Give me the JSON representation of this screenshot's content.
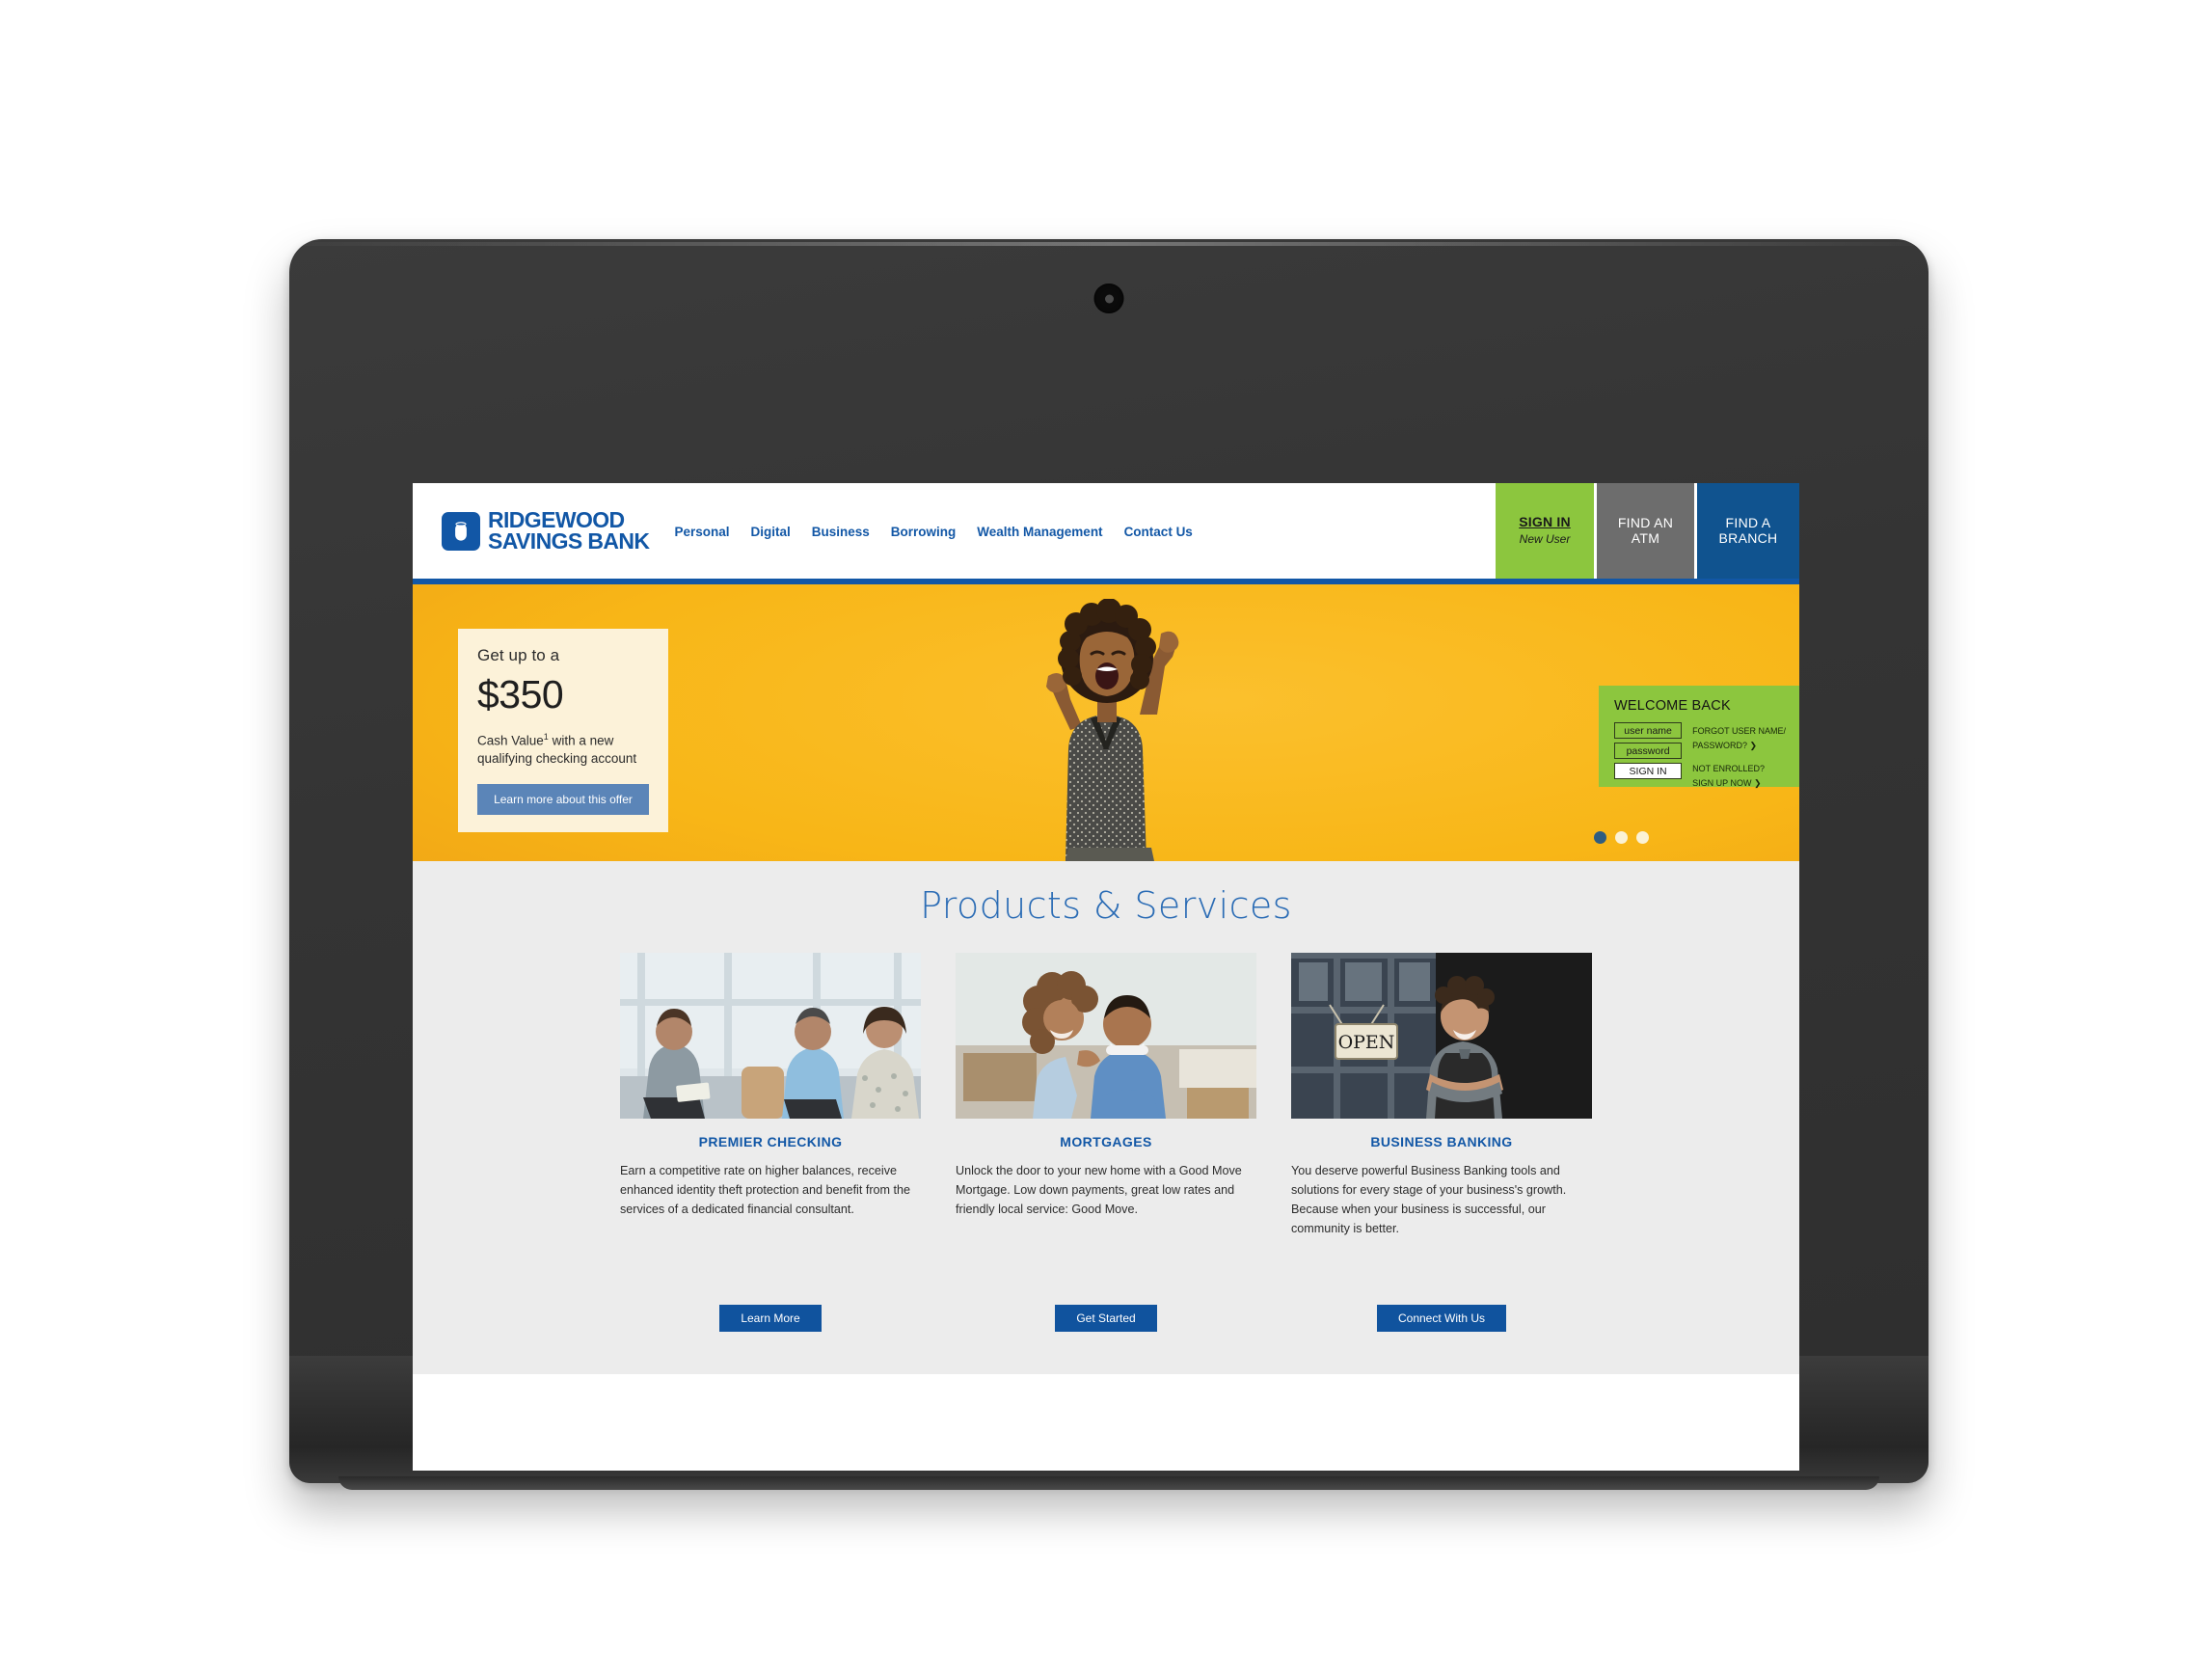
{
  "site": {
    "brand": {
      "line1": "RIDGEWOOD",
      "line2": "SAVINGS BANK",
      "mark": "acorn-shield-logo"
    },
    "nav": [
      {
        "label": "Personal"
      },
      {
        "label": "Digital"
      },
      {
        "label": "Business"
      },
      {
        "label": "Borrowing"
      },
      {
        "label": "Wealth Management"
      },
      {
        "label": "Contact Us"
      }
    ],
    "header_actions": {
      "signin": {
        "title": "SIGN IN",
        "sub": "New User",
        "color": "#8cc63e"
      },
      "atm": {
        "title": "FIND AN ATM",
        "line1": "FIND AN",
        "line2": "ATM",
        "color": "#6d6d6d"
      },
      "branch": {
        "title": "FIND A BRANCH",
        "line1": "FIND A",
        "line2": "BRANCH",
        "color": "#10538f"
      }
    },
    "accent_color": "#1257a6"
  },
  "hero": {
    "background_color": "#f8b617",
    "image_alt": "woman celebrating with raised fists",
    "offer": {
      "kicker": "Get up to a",
      "amount": "$350",
      "description_1": "Cash Value",
      "footnote": "1",
      "description_2": "with a new qualifying checking account",
      "button": "Learn more about this offer",
      "card_color": "#fcf2d9",
      "button_color": "#5b85b8"
    },
    "carousel": {
      "total": 3,
      "active_index": 0
    }
  },
  "login": {
    "title": "WELCOME BACK",
    "username_placeholder": "user name",
    "password_placeholder": "password",
    "submit_label": "SIGN IN",
    "links": [
      {
        "line1": "FORGOT USER NAME/",
        "line2": "PASSWORD? ❯"
      },
      {
        "line1": "NOT ENROLLED?",
        "line2": "SIGN UP NOW ❯"
      }
    ],
    "panel_color": "#8cc63e"
  },
  "products": {
    "title": "Products & Services",
    "background_color": "#ececec",
    "cards": [
      {
        "title": "PREMIER CHECKING",
        "text": "Earn a competitive rate on higher balances, receive enhanced identity theft protection and benefit from the services of a dedicated financial consultant.",
        "button": "Learn More",
        "image_alt": "financial consultant meeting with a couple"
      },
      {
        "title": "MORTGAGES",
        "text": "Unlock the door to your new home with a Good Move Mortgage. Low down payments, great low rates and friendly local service: Good Move.",
        "button": "Get Started",
        "image_alt": "smiling couple at home"
      },
      {
        "title": "BUSINESS BANKING",
        "text": "You deserve powerful Business Banking tools and solutions for every stage of your business's growth. Because when your business is successful, our community is better.",
        "button": "Connect With Us",
        "image_alt": "shop owner standing by an OPEN sign"
      }
    ]
  },
  "device": {
    "type": "tablet",
    "webcam": "camera-lens",
    "speaker": "speaker-grille"
  }
}
